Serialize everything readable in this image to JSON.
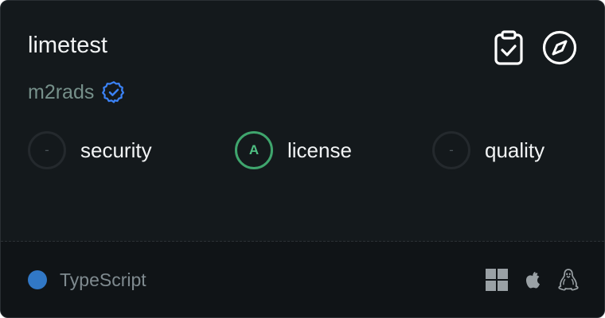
{
  "package": {
    "name": "limetest",
    "organization": "m2rads",
    "verified": true
  },
  "actions": {
    "clipboard_icon": "clipboard-check-icon",
    "explore_icon": "compass-icon"
  },
  "scores": [
    {
      "grade": "-",
      "label": "security"
    },
    {
      "grade": "A",
      "label": "license"
    },
    {
      "grade": "-",
      "label": "quality"
    }
  ],
  "language": {
    "name": "TypeScript",
    "color": "#3178c6"
  },
  "platforms": [
    "windows-icon",
    "apple-icon",
    "linux-icon"
  ],
  "colors": {
    "card_background": "#14191c",
    "footer_background": "#101417",
    "verified_accent": "#3b82f6",
    "grade_a": "#3fa56d"
  }
}
